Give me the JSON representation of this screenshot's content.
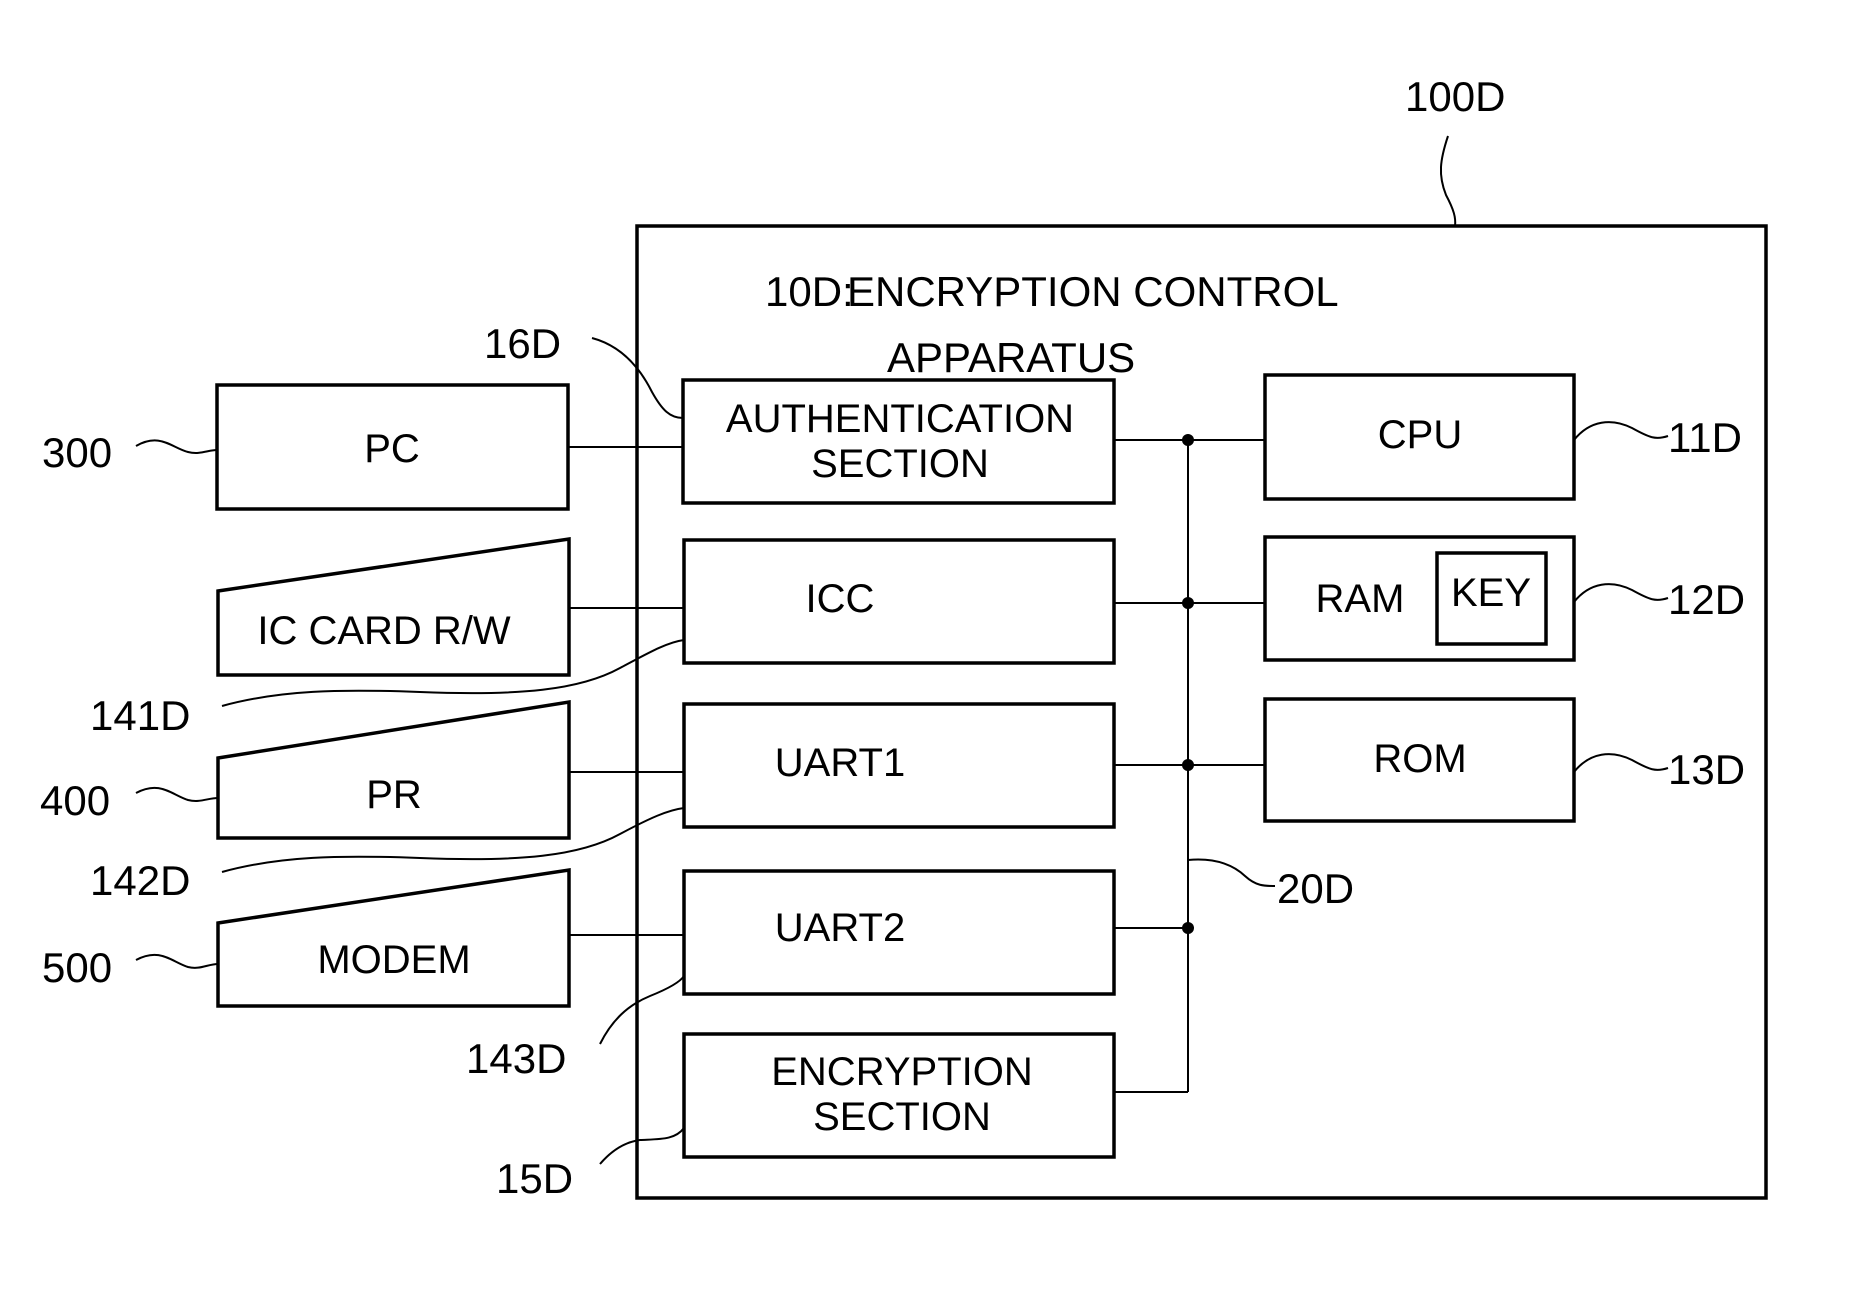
{
  "diagram": {
    "system_ref": "100D",
    "apparatus": {
      "ref": "10D:",
      "title_line1": "ENCRYPTION CONTROL",
      "title_line2": "APPARATUS"
    },
    "external_devices": [
      {
        "id": "pc",
        "label": "PC",
        "ref": "300",
        "shape": "rectangle"
      },
      {
        "id": "ic-card-rw",
        "label": "IC CARD R/W",
        "ref": null,
        "shape": "slanted-top"
      },
      {
        "id": "pr",
        "label": "PR",
        "ref": "400",
        "shape": "slanted-top"
      },
      {
        "id": "modem",
        "label": "MODEM",
        "ref": "500",
        "shape": "slanted-top"
      }
    ],
    "internal_left_blocks": [
      {
        "id": "authentication",
        "line1": "AUTHENTICATION",
        "line2": "SECTION",
        "ref": "16D"
      },
      {
        "id": "icc",
        "line1": "ICC",
        "line2": "",
        "ref": "141D"
      },
      {
        "id": "uart1",
        "line1": "UART1",
        "line2": "",
        "ref": "142D"
      },
      {
        "id": "uart2",
        "line1": "UART2",
        "line2": "",
        "ref": "143D"
      },
      {
        "id": "encryption",
        "line1": "ENCRYPTION",
        "line2": "SECTION",
        "ref": "15D"
      }
    ],
    "internal_right_blocks": [
      {
        "id": "cpu",
        "label": "CPU",
        "ref": "11D"
      },
      {
        "id": "ram",
        "label": "RAM",
        "inner_label": "KEY",
        "ref": "12D"
      },
      {
        "id": "rom",
        "label": "ROM",
        "ref": "13D"
      }
    ],
    "bus": {
      "ref": "20D"
    },
    "connections": [
      [
        "PC",
        "AUTHENTICATION SECTION"
      ],
      [
        "IC CARD R/W",
        "ICC"
      ],
      [
        "PR",
        "UART1"
      ],
      [
        "MODEM",
        "UART2"
      ],
      [
        "AUTHENTICATION SECTION",
        "20D",
        "CPU"
      ],
      [
        "ICC",
        "20D",
        "RAM"
      ],
      [
        "UART1",
        "20D",
        "ROM"
      ],
      [
        "UART2",
        "20D"
      ],
      [
        "ENCRYPTION SECTION",
        "20D"
      ]
    ]
  }
}
